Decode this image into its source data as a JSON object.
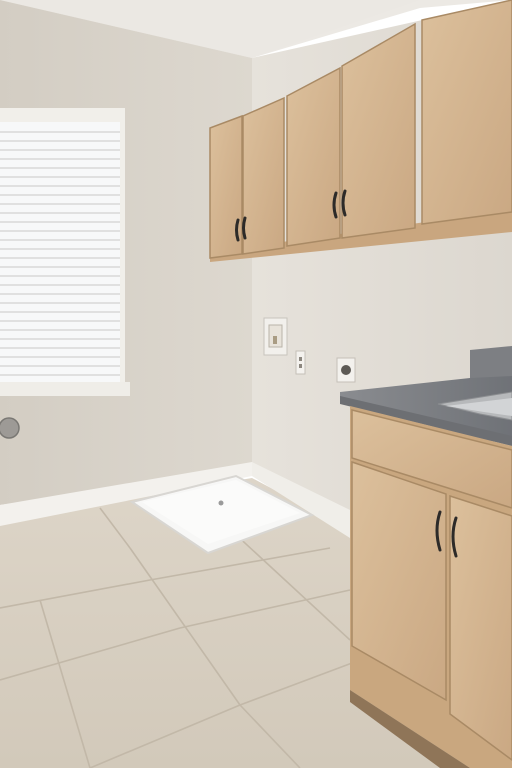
{
  "scene": {
    "room": "laundry-room",
    "colors": {
      "wall_left": "#d9d4cb",
      "wall_right": "#e2ddd6",
      "ceiling": "#ebe8e3",
      "floor": "#d8d0c2",
      "grout": "#c3b9a9",
      "cabinet": "#d7b994",
      "cabinet_dark": "#b89670",
      "granite": "#7f8287",
      "trim": "#f2f0ec",
      "window_glass": "#f6f7f8"
    },
    "icons": [
      "window-blinds-icon",
      "door-knob-icon",
      "washer-drain-pan-icon",
      "water-valve-box-icon",
      "outlet-icon",
      "dryer-outlet-icon",
      "sink-icon",
      "cabinet-handle-icon"
    ]
  }
}
